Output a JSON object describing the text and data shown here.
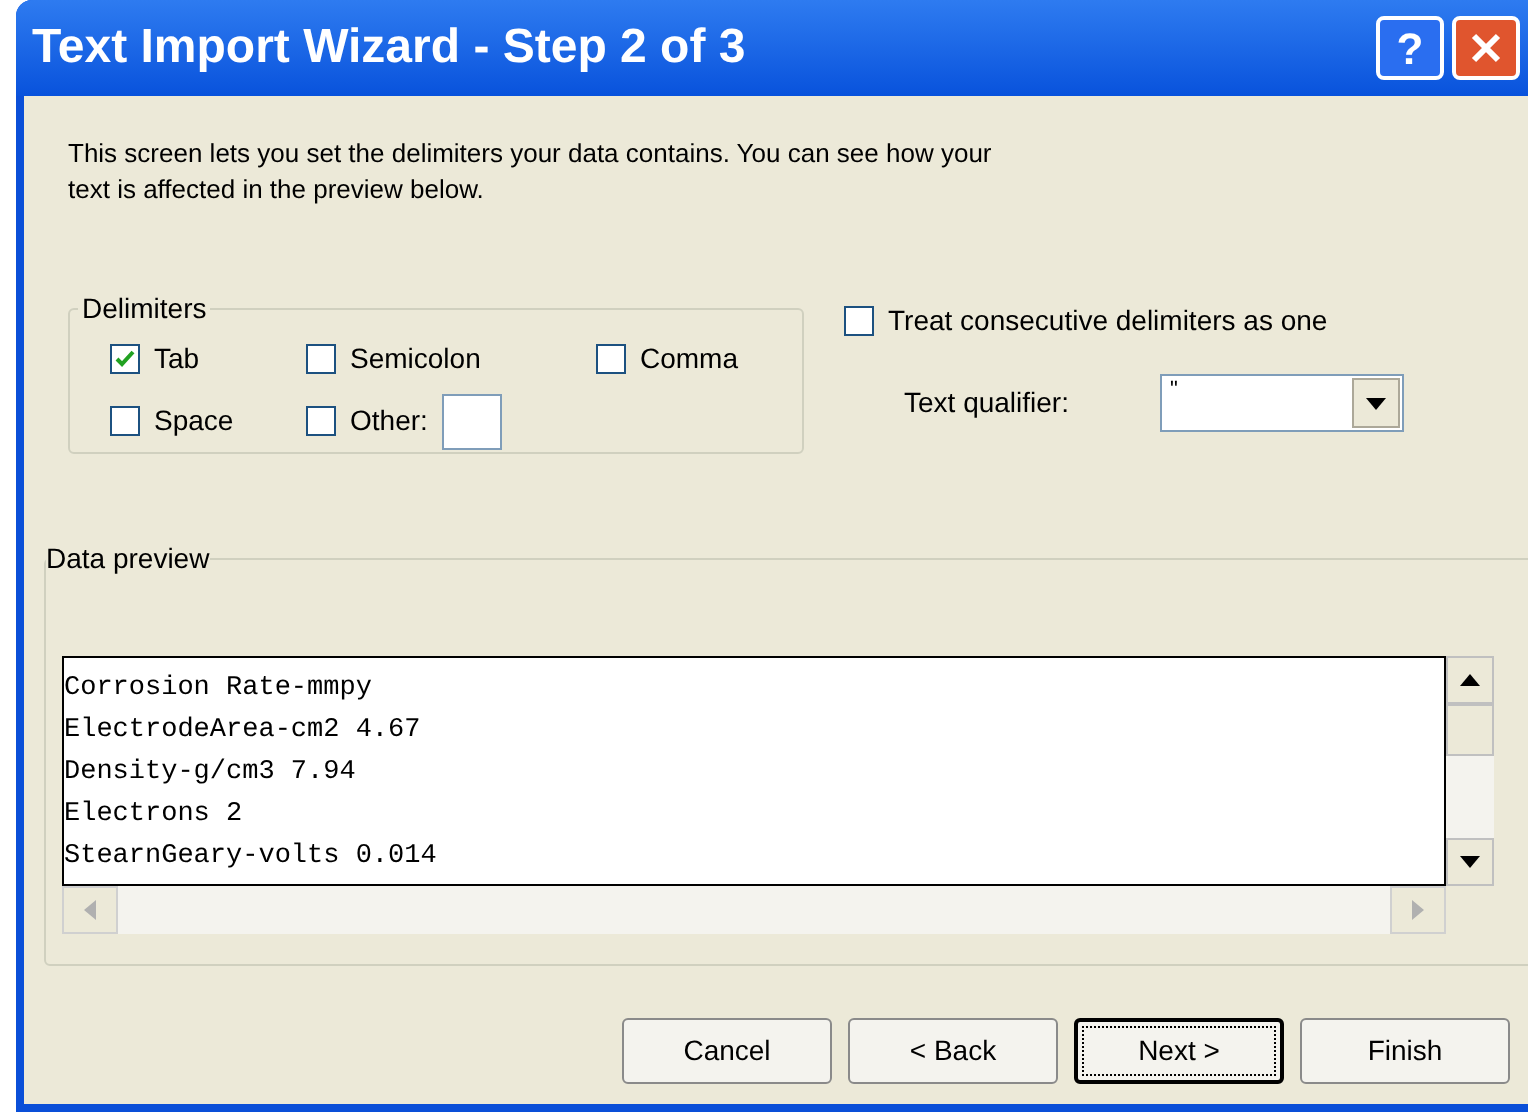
{
  "window": {
    "title": "Text Import Wizard - Step 2 of 3",
    "help_button": "?"
  },
  "description": "This screen lets you set the delimiters your data contains.  You can see how your text is affected in the preview below.",
  "delimiters": {
    "title": "Delimiters",
    "options": [
      {
        "label": "Tab",
        "checked": true
      },
      {
        "label": "Semicolon",
        "checked": false
      },
      {
        "label": "Comma",
        "checked": false
      },
      {
        "label": "Space",
        "checked": false
      },
      {
        "label": "Other:",
        "checked": false
      }
    ]
  },
  "consecutive": {
    "label": "Treat consecutive delimiters as one",
    "checked": false
  },
  "text_qualifier": {
    "label": "Text qualifier:",
    "value": "\""
  },
  "data_preview": {
    "title": "Data preview",
    "lines": [
      "Corrosion Rate-mmpy",
      "ElectrodeArea-cm2 4.67",
      "Density-g/cm3 7.94",
      "Electrons 2",
      "StearnGeary-volts 0.014"
    ]
  },
  "buttons": [
    {
      "label": "Cancel",
      "focused": false
    },
    {
      "label": "< Back",
      "focused": false
    },
    {
      "label": "Next >",
      "focused": true
    },
    {
      "label": "Finish",
      "focused": false
    }
  ]
}
